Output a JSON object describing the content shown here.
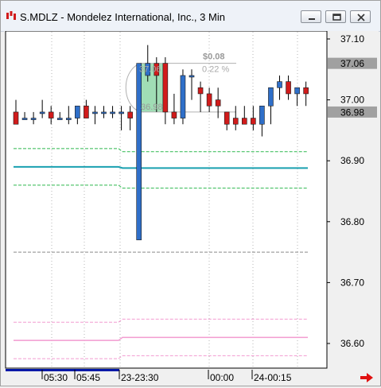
{
  "window": {
    "title": "S.MDLZ - Mondelez International, Inc., 3 Min",
    "buttons": [
      "minimize",
      "restore",
      "close"
    ]
  },
  "icons": {
    "app": "candlestick-chart-icon",
    "minimize": "minimize-icon",
    "restore": "restore-icon",
    "close": "close-icon",
    "scroll": "right-arrow-icon"
  },
  "colors": {
    "up": "#2f6fc9",
    "down": "#d11b1b",
    "upper_band": "#2db84e",
    "mid_line": "#1aa0b0",
    "pink_band": "#f29bd0",
    "measure_fill": "#8fd7a8",
    "price_tag": "#a0a0a0",
    "time_bar": "#0018a8",
    "scroll_arrow": "#e01010"
  },
  "axis": {
    "y_labels": [
      "37.10",
      "37.00",
      "36.90",
      "36.80",
      "36.70",
      "36.60"
    ],
    "y_values": [
      37.1,
      37.0,
      36.9,
      36.8,
      36.7,
      36.6
    ],
    "x_labels": [
      "05:30",
      "05:45",
      "23-23:30",
      "00:00",
      "24-00:15"
    ]
  },
  "price_tags": [
    {
      "label": "37.06",
      "value": 37.06
    },
    {
      "label": "36.98",
      "value": 36.98
    }
  ],
  "measure_tool": {
    "change": "$0.08",
    "percent": "0.22 %",
    "start_price": "37.06",
    "end_price": "36.98"
  },
  "chart_data": {
    "type": "candlestick",
    "title": "",
    "ylim": [
      36.55,
      37.12
    ],
    "candles": [
      {
        "o": 36.98,
        "h": 37.0,
        "l": 36.96,
        "c": 36.96
      },
      {
        "o": 36.97,
        "h": 36.98,
        "l": 36.97,
        "c": 36.97
      },
      {
        "o": 36.97,
        "h": 36.98,
        "l": 36.96,
        "c": 36.97
      },
      {
        "o": 36.98,
        "h": 37.0,
        "l": 36.97,
        "c": 36.98
      },
      {
        "o": 36.98,
        "h": 36.99,
        "l": 36.96,
        "c": 36.97
      },
      {
        "o": 36.97,
        "h": 36.98,
        "l": 36.97,
        "c": 36.97
      },
      {
        "o": 36.97,
        "h": 36.99,
        "l": 36.96,
        "c": 36.97
      },
      {
        "o": 36.97,
        "h": 36.99,
        "l": 36.96,
        "c": 36.99
      },
      {
        "o": 36.99,
        "h": 37.0,
        "l": 36.97,
        "c": 36.97
      },
      {
        "o": 36.98,
        "h": 36.99,
        "l": 36.96,
        "c": 36.98
      },
      {
        "o": 36.98,
        "h": 36.99,
        "l": 36.97,
        "c": 36.98
      },
      {
        "o": 36.98,
        "h": 36.99,
        "l": 36.97,
        "c": 36.98
      },
      {
        "o": 36.98,
        "h": 36.99,
        "l": 36.95,
        "c": 36.98
      },
      {
        "o": 36.98,
        "h": 36.99,
        "l": 36.95,
        "c": 36.97
      },
      {
        "o": 36.77,
        "h": 37.06,
        "l": 36.77,
        "c": 37.06
      },
      {
        "o": 37.04,
        "h": 37.09,
        "l": 37.03,
        "c": 37.06
      },
      {
        "o": 37.06,
        "h": 37.07,
        "l": 36.98,
        "c": 37.04
      },
      {
        "o": 37.06,
        "h": 37.07,
        "l": 36.96,
        "c": 36.98
      },
      {
        "o": 36.98,
        "h": 37.01,
        "l": 36.96,
        "c": 36.97
      },
      {
        "o": 36.97,
        "h": 37.05,
        "l": 36.96,
        "c": 37.04
      },
      {
        "o": 37.04,
        "h": 37.05,
        "l": 37.0,
        "c": 37.04
      },
      {
        "o": 37.02,
        "h": 37.03,
        "l": 36.98,
        "c": 37.01
      },
      {
        "o": 37.01,
        "h": 37.02,
        "l": 36.98,
        "c": 36.99
      },
      {
        "o": 37.0,
        "h": 37.02,
        "l": 36.97,
        "c": 36.99
      },
      {
        "o": 36.98,
        "h": 36.98,
        "l": 36.95,
        "c": 36.96
      },
      {
        "o": 36.97,
        "h": 36.99,
        "l": 36.95,
        "c": 36.96
      },
      {
        "o": 36.97,
        "h": 36.99,
        "l": 36.96,
        "c": 36.96
      },
      {
        "o": 36.97,
        "h": 36.99,
        "l": 36.95,
        "c": 36.96
      },
      {
        "o": 36.96,
        "h": 36.98,
        "l": 36.94,
        "c": 36.99
      },
      {
        "o": 36.99,
        "h": 37.01,
        "l": 36.96,
        "c": 37.02
      },
      {
        "o": 37.02,
        "h": 37.04,
        "l": 37.0,
        "c": 37.03
      },
      {
        "o": 37.03,
        "h": 37.04,
        "l": 37.0,
        "c": 37.01
      },
      {
        "o": 37.01,
        "h": 37.02,
        "l": 36.99,
        "c": 37.02
      },
      {
        "o": 37.02,
        "h": 37.03,
        "l": 36.99,
        "c": 37.01
      }
    ],
    "overlays": [
      {
        "name": "upper-band",
        "style": "dashed",
        "before": 36.92,
        "after": 36.915
      },
      {
        "name": "mid-line",
        "style": "solid",
        "before": 36.89,
        "after": 36.888
      },
      {
        "name": "lower-band",
        "style": "dashed",
        "before": 36.86,
        "after": 36.855
      },
      {
        "name": "low-reference",
        "style": "dashed",
        "value": 36.75
      },
      {
        "name": "pink-upper",
        "style": "dashed",
        "before": 36.635,
        "after": 36.64
      },
      {
        "name": "pink-mid",
        "style": "solid",
        "before": 36.605,
        "after": 36.61
      },
      {
        "name": "pink-lower",
        "style": "dashed",
        "before": 36.575,
        "after": 36.58
      }
    ]
  }
}
